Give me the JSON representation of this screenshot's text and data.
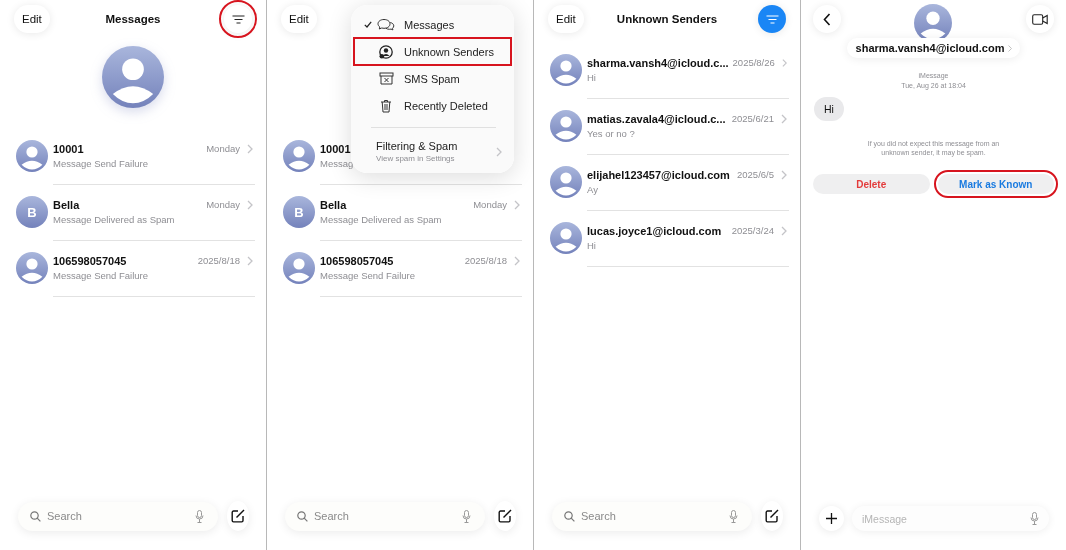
{
  "panels": [
    {
      "kind": "inbox",
      "edit": "Edit",
      "title": "Messages",
      "filter": {
        "active": false,
        "highlighted": true
      },
      "big_avatar": true,
      "conversations": [
        {
          "name": "10001",
          "preview": "Message Send Failure",
          "date": "Monday",
          "avatar": {
            "kind": "person"
          }
        },
        {
          "name": "Bella",
          "preview": "Message Delivered as Spam",
          "date": "Monday",
          "avatar": {
            "kind": "initial",
            "text": "B"
          }
        },
        {
          "name": "106598057045",
          "preview": "Message Send Failure",
          "date": "2025/8/18",
          "avatar": {
            "kind": "person"
          }
        }
      ],
      "search": {
        "placeholder": "Search"
      }
    },
    {
      "kind": "inbox",
      "edit": "Edit",
      "big_avatar": false,
      "menu": {
        "items": [
          {
            "label": "Messages",
            "checked": true,
            "highlighted": false
          },
          {
            "label": "Unknown Senders",
            "checked": false,
            "highlighted": true
          },
          {
            "label": "SMS Spam",
            "checked": false,
            "highlighted": false
          },
          {
            "label": "Recently Deleted",
            "checked": false,
            "highlighted": false
          }
        ],
        "footer": {
          "title": "Filtering & Spam",
          "subtitle": "View spam in Settings"
        }
      },
      "conversations": [
        {
          "name": "10001",
          "preview": "Messag",
          "avatar": {
            "kind": "person"
          }
        },
        {
          "name": "Bella",
          "preview": "Message Delivered as Spam",
          "date": "Monday",
          "avatar": {
            "kind": "initial",
            "text": "B"
          }
        },
        {
          "name": "106598057045",
          "preview": "Message Send Failure",
          "date": "2025/8/18",
          "avatar": {
            "kind": "person"
          }
        }
      ],
      "search": {
        "placeholder": "Search"
      }
    },
    {
      "kind": "inbox",
      "edit": "Edit",
      "title": "Unknown Senders",
      "filter": {
        "active": true,
        "highlighted": false
      },
      "big_avatar": false,
      "conversations": [
        {
          "name": "sharma.vansh4@icloud.c...",
          "preview": "Hi",
          "date": "2025/8/26",
          "avatar": {
            "kind": "person"
          }
        },
        {
          "name": "matias.zavala4@icloud.c...",
          "preview": "Yes or no ?",
          "date": "2025/6/21",
          "avatar": {
            "kind": "person"
          }
        },
        {
          "name": "elijahel123457@icloud.com",
          "preview": "Ay",
          "date": "2025/6/5",
          "avatar": {
            "kind": "person"
          }
        },
        {
          "name": "lucas.joyce1@icloud.com",
          "preview": "Hi",
          "date": "2025/3/24",
          "avatar": {
            "kind": "person"
          }
        }
      ],
      "search": {
        "placeholder": "Search"
      }
    },
    {
      "kind": "chat",
      "contact": "sharma.vansh4@icloud.com",
      "service": "iMessage",
      "timestamp": "Tue, Aug 26 at 18:04",
      "messages": [
        {
          "text": "Hi"
        }
      ],
      "notice": "If you did not expect this message from an unknown sender, it may be spam.",
      "actions": [
        {
          "label": "Delete",
          "kind": "destructive",
          "highlighted": false
        },
        {
          "label": "Mark as Known",
          "kind": "primary",
          "highlighted": true
        }
      ],
      "composer": {
        "placeholder": "iMessage"
      }
    }
  ]
}
